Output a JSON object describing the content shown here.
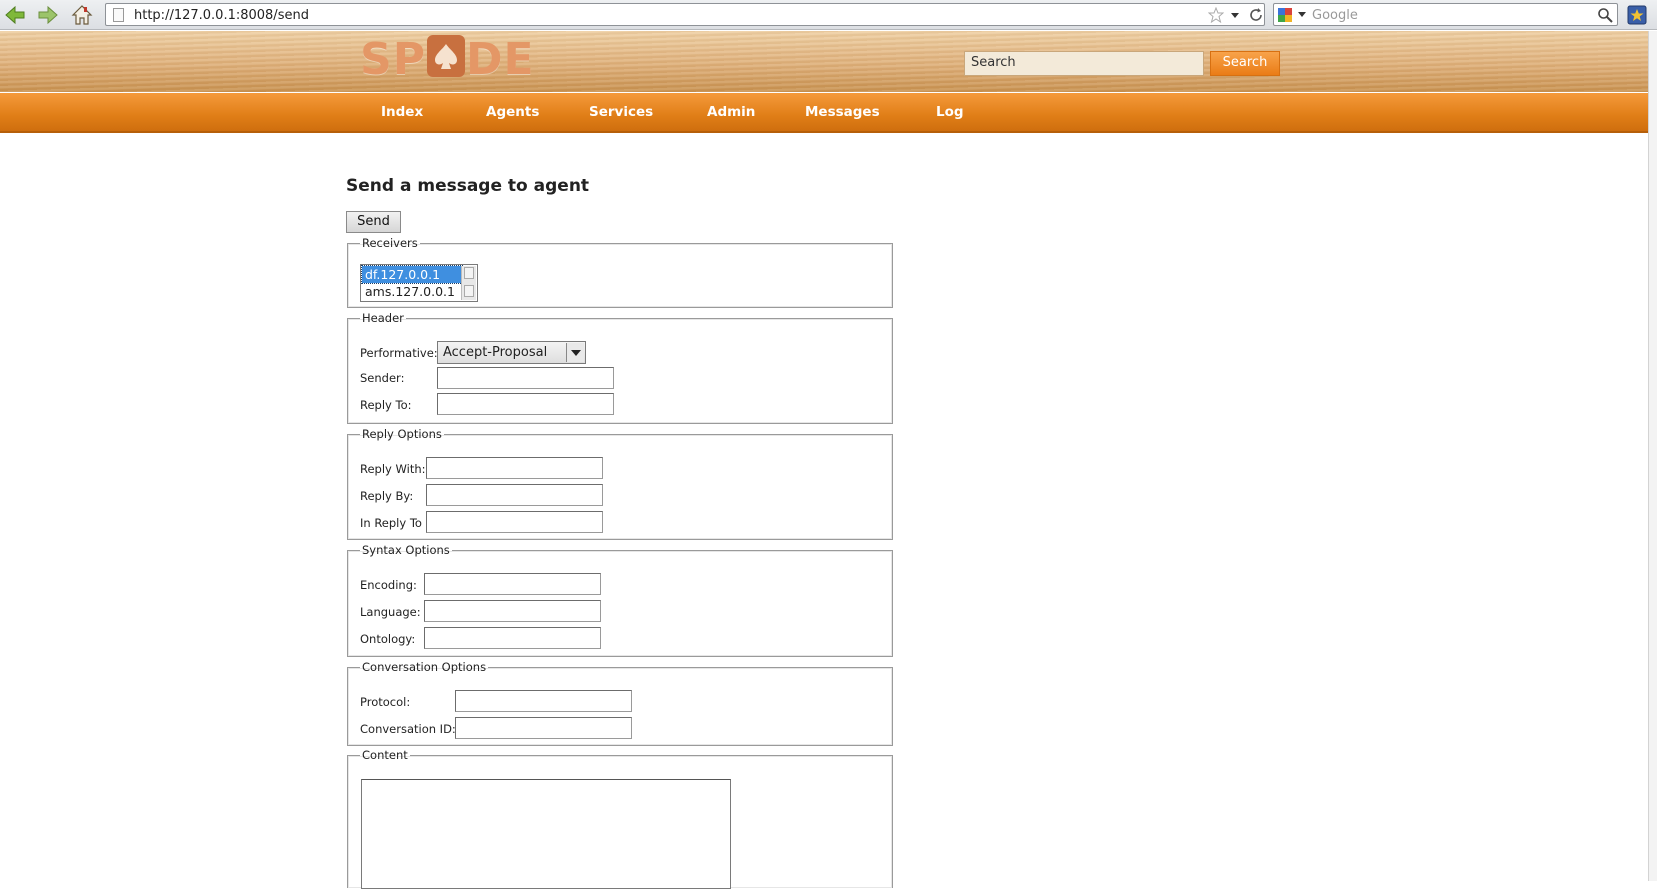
{
  "browser": {
    "url": "http://127.0.0.1:8008/send",
    "search_placeholder": "Google"
  },
  "site": {
    "logo_text_left": "SP",
    "logo_text_right": "DE",
    "search_placeholder": "Search",
    "search_button": "Search"
  },
  "nav": {
    "items": [
      {
        "label": "Index"
      },
      {
        "label": "Agents"
      },
      {
        "label": "Services"
      },
      {
        "label": "Admin"
      },
      {
        "label": "Messages"
      },
      {
        "label": "Log"
      }
    ]
  },
  "main": {
    "title": "Send a message to agent",
    "send_button": "Send"
  },
  "receivers": {
    "legend": "Receivers",
    "items": [
      "df.127.0.0.1",
      "ams.127.0.0.1"
    ],
    "selected": "df.127.0.0.1"
  },
  "header_group": {
    "legend": "Header",
    "performative_label": "Performative:",
    "performative_value": "Accept-Proposal",
    "sender_label": "Sender:",
    "sender_value": "",
    "reply_to_label": "Reply To:",
    "reply_to_value": ""
  },
  "reply_options": {
    "legend": "Reply Options",
    "reply_with_label": "Reply With:",
    "reply_by_label": "Reply By:",
    "in_reply_to_label": "In Reply To"
  },
  "syntax_options": {
    "legend": "Syntax Options",
    "encoding_label": "Encoding:",
    "language_label": "Language:",
    "ontology_label": "Ontology:"
  },
  "conversation_options": {
    "legend": "Conversation Options",
    "protocol_label": "Protocol:",
    "conversation_id_label": "Conversation ID:"
  },
  "content": {
    "legend": "Content"
  },
  "colors": {
    "nav_orange": "#e07e17",
    "header_wood": "#dfb07a",
    "logo": "#e49766",
    "search_button": "#ea7c16",
    "selection_blue": "#3f8fe0"
  }
}
